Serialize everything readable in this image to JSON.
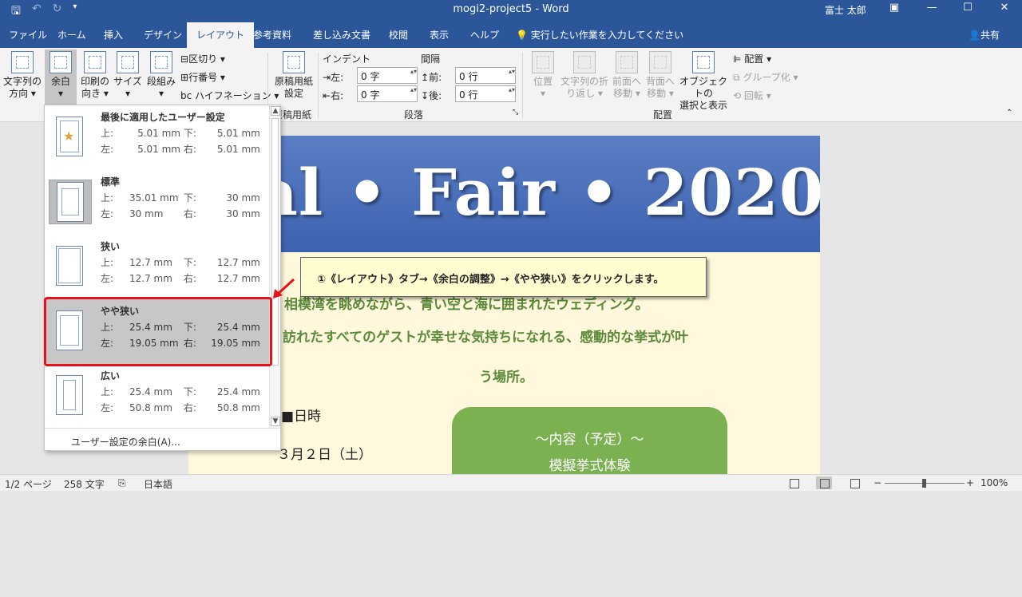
{
  "window": {
    "title": "mogi2-project5 - Word",
    "user": "富士 太郎",
    "qat": [
      "save-icon",
      "undo-icon",
      "redo-icon",
      "customize-icon"
    ],
    "controls": [
      "ribbon-display-icon",
      "minimize-icon",
      "restore-icon",
      "close-icon"
    ]
  },
  "tabs": [
    {
      "label": "ファイル"
    },
    {
      "label": "ホーム"
    },
    {
      "label": "挿入"
    },
    {
      "label": "デザイン"
    },
    {
      "label": "レイアウト",
      "active": true
    },
    {
      "label": "参考資料"
    },
    {
      "label": "差し込み文書"
    },
    {
      "label": "校閲"
    },
    {
      "label": "表示"
    },
    {
      "label": "ヘルプ"
    }
  ],
  "tell_me": "実行したい作業を入力してください",
  "share": "共有",
  "ribbon": {
    "page_setup": {
      "text_direction": [
        "文字列の",
        "方向"
      ],
      "margins": "余白",
      "orientation": [
        "印刷の",
        "向き"
      ],
      "size": "サイズ",
      "columns": "段組み",
      "breaks": "区切り",
      "line_numbers": "行番号",
      "hyphenation": "ハイフネーション"
    },
    "manuscript": {
      "button": [
        "原稿用紙",
        "設定"
      ],
      "group": "原稿用紙"
    },
    "paragraph": {
      "indent_label": "インデント",
      "spacing_label": "間隔",
      "left_label": "左:",
      "left_value": "0 字",
      "right_label": "右:",
      "right_value": "0 字",
      "before_label": "前:",
      "before_value": "0 行",
      "after_label": "後:",
      "after_value": "0 行",
      "group": "段落"
    },
    "arrange": {
      "position": "位置",
      "wrap_text": [
        "文字列の折",
        "り返し"
      ],
      "bring_forward": [
        "前面へ",
        "移動"
      ],
      "send_backward": [
        "背面へ",
        "移動"
      ],
      "selection_pane": [
        "オブジェクトの",
        "選択と表示"
      ],
      "align": "配置",
      "group_btn": "グループ化",
      "rotate": "回転",
      "group": "配置"
    }
  },
  "margins_menu": {
    "options": [
      {
        "name": "最後に適用したユーザー設定",
        "top_label": "上:",
        "top": "5.01 mm",
        "bottom_label": "下:",
        "bottom": "5.01 mm",
        "left_label": "左:",
        "left": "5.01 mm",
        "right_label": "右:",
        "right": "5.01 mm",
        "icon": "star-icon"
      },
      {
        "name": "標準",
        "top_label": "上:",
        "top": "35.01 mm",
        "bottom_label": "下:",
        "bottom": "30 mm",
        "left_label": "左:",
        "left": "30 mm",
        "right_label": "右:",
        "right": "30 mm"
      },
      {
        "name": "狭い",
        "top_label": "上:",
        "top": "12.7 mm",
        "bottom_label": "下:",
        "bottom": "12.7 mm",
        "left_label": "左:",
        "left": "12.7 mm",
        "right_label": "右:",
        "right": "12.7 mm"
      },
      {
        "name": "やや狭い",
        "top_label": "上:",
        "top": "25.4 mm",
        "bottom_label": "下:",
        "bottom": "25.4 mm",
        "left_label": "左:",
        "left": "19.05 mm",
        "right_label": "右:",
        "right": "19.05 mm",
        "selected": true
      },
      {
        "name": "広い",
        "top_label": "上:",
        "top": "25.4 mm",
        "bottom_label": "下:",
        "bottom": "25.4 mm",
        "left_label": "左:",
        "left": "50.8 mm",
        "right_label": "右:",
        "right": "50.8 mm"
      }
    ],
    "custom": "ユーザー設定の余白(A)..."
  },
  "callout": "①《レイアウト》タブ→《余白の調整》→《やや狭い》をクリックします。",
  "document": {
    "banner": "Bridal • Fair • 2020",
    "line1": "相模湾を眺めながら、青い空と海に囲まれたウェディング。",
    "line2": "訪れたすべてのゲストが幸せな気持ちになれる、感動的な挙式が叶",
    "line3": "う場所。",
    "date_heading": "■日時",
    "date": "３月２日（土）",
    "box_title": "～内容（予定）～",
    "box_item": "模擬挙式体験"
  },
  "status": {
    "page": "1/2 ページ",
    "words": "258 文字",
    "language": "日本語",
    "zoom": "100%"
  },
  "colors": {
    "accent": "#2b579a",
    "highlight": "#e5121a",
    "banner": "#3c62b0",
    "green": "#7bb151"
  }
}
